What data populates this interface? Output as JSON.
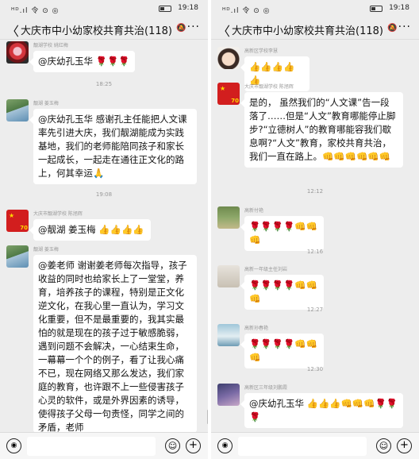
{
  "status": {
    "signal": "ᴴᴰ.ıl 令 ⊙ ◎",
    "time": "19:18"
  },
  "chat": {
    "title": "大庆市中小幼家校共育共治(118)",
    "back": "〈",
    "more": "···",
    "mute": "🔕"
  },
  "input": {
    "voice": "◉",
    "emoji": "☺",
    "plus": "+"
  },
  "left": {
    "m1": {
      "sender": "靓湖学校 姚红梅",
      "text": "@庆幼孔玉华 🌹🌹🌹"
    },
    "ts1": "18:25",
    "m2": {
      "sender": "靓湖 姜玉梅",
      "text": "@庆幼孔玉华 感谢孔主任能把人文课率先引进大庆，我们靓湖能成为实践基地，我们的老师能陪同孩子和家长一起成长，一起走在通往正文化的路上，何其幸运🙏"
    },
    "ts2": "19:08",
    "m3": {
      "sender": "大庆市靓湖学校 陈旭辉",
      "text": "@靓湖 姜玉梅 👍👍👍👍"
    },
    "m4": {
      "sender": "靓湖 姜玉梅",
      "text": "@姜老师 谢谢姜老师每次指导，孩子收益的同时也给家长上了一堂堂，养育，培养孩子的课程，特别是正文化逆文化，在我心里一直认为，学习文化重要，但不是最重要的，我其实最怕的就是现在的孩子过于敏感脆弱，遇到问题不会解决，一心结束生命，一幕幕一个个的例子，看了让我心痛不已，现在网络又那么发达，我们家庭的教育，也许跟不上一些侵害孩子心灵的软件，或是外界因素的诱导，使得孩子父母一句责怪，同学之间的矛盾，老师"
    }
  },
  "right": {
    "m1": {
      "sender": "高新区学校李慧",
      "text": "👍👍👍👍👍"
    },
    "m2": {
      "sender": "大庆市靓湖学校 陈旭辉",
      "text": "是的， 虽然我们的“人文课”告一段落了……但是“人文”教育哪能停止脚步?“立德树人”的教育哪能容我们歇息啊?“人文”教育，家校共育共治，我们一直在路上。👊👊👊👊👊👊"
    },
    "ts1": "12:12",
    "m3": {
      "sender": "高新付艳",
      "text": "🌹🌹🌹🌹👊👊👊"
    },
    "ts2": "12:16",
    "m4": {
      "sender": "高新一年级主任刘岩",
      "text": "🌹🌹🌹🌹👊👊👊"
    },
    "ts3": "12:27",
    "m5": {
      "sender": "高新孙春艳",
      "text": "🌹🌹🌹🌹👊👊👊"
    },
    "ts4": "12:30",
    "m6": {
      "sender": "高新区三年级刘鹏霞",
      "text": "@庆幼孔玉华 👍👍👍👊👊👊🌹🌹🌹"
    }
  }
}
